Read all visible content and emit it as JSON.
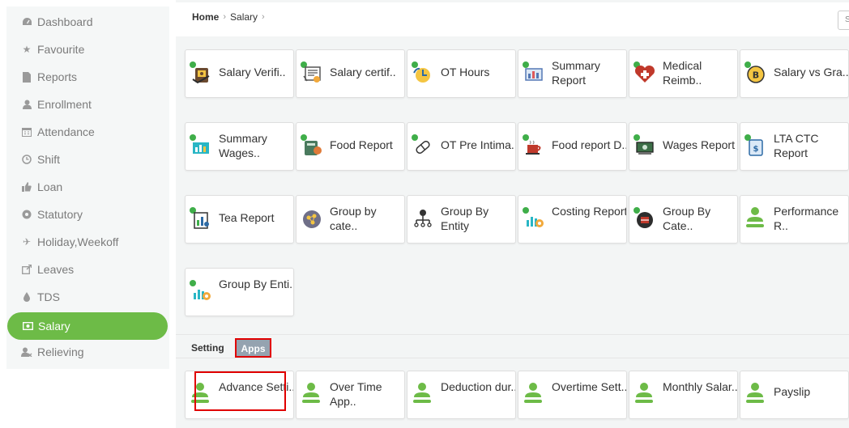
{
  "sidebar": {
    "items": [
      {
        "label": "Dashboard",
        "icon": "dashboard-icon"
      },
      {
        "label": "Favourite",
        "icon": "star-icon"
      },
      {
        "label": "Reports",
        "icon": "file-icon"
      },
      {
        "label": "Enrollment",
        "icon": "user-icon"
      },
      {
        "label": "Attendance",
        "icon": "calendar-icon"
      },
      {
        "label": "Shift",
        "icon": "clock-icon"
      },
      {
        "label": "Loan",
        "icon": "thumbs-up-icon"
      },
      {
        "label": "Statutory",
        "icon": "gear-icon"
      },
      {
        "label": "Holiday,Weekoff",
        "icon": "plane-icon"
      },
      {
        "label": "Leaves",
        "icon": "external-link-icon"
      },
      {
        "label": "TDS",
        "icon": "drop-icon"
      },
      {
        "label": "Salary",
        "icon": "money-icon",
        "active": true
      },
      {
        "label": "Relieving",
        "icon": "user-minus-icon"
      }
    ]
  },
  "breadcrumb": {
    "home": "Home",
    "current": "Salary",
    "sep": "›"
  },
  "top_search": {
    "text": "S"
  },
  "reports": [
    {
      "label": "Salary Verifi..",
      "icon": "salary-verification-icon"
    },
    {
      "label": "Salary certif..",
      "icon": "salary-certificate-icon"
    },
    {
      "label": "OT Hours",
      "icon": "ot-hours-icon"
    },
    {
      "label": "Summary Report",
      "icon": "summary-report-icon"
    },
    {
      "label": "Medical Reimb..",
      "icon": "medical-icon"
    },
    {
      "label": "Salary vs Gra..",
      "icon": "bitcoin-icon"
    },
    {
      "label": "Summary Wages..",
      "icon": "summary-wages-icon"
    },
    {
      "label": "Food Report",
      "icon": "food-icon"
    },
    {
      "label": "OT Pre Intima..",
      "icon": "pill-icon"
    },
    {
      "label": "Food report D..",
      "icon": "coffee-icon"
    },
    {
      "label": "Wages Report",
      "icon": "wages-icon"
    },
    {
      "label": "LTA CTC Report",
      "icon": "lta-icon"
    },
    {
      "label": "Tea Report",
      "icon": "tea-report-icon"
    },
    {
      "label": "Group by cate..",
      "icon": "group-category-icon"
    },
    {
      "label": "Group By Entity",
      "icon": "entity-icon"
    },
    {
      "label": "Costing Report",
      "icon": "costing-icon"
    },
    {
      "label": "Group By Cate..",
      "icon": "group-by-cate-icon"
    },
    {
      "label": "Performance R..",
      "icon": "person-icon"
    },
    {
      "label": "Group By Enti..",
      "icon": "chart-gear-icon"
    }
  ],
  "tabs": {
    "setting": "Setting",
    "apps": "Apps"
  },
  "apps": [
    {
      "label": "Advance Setti..",
      "icon": "person-icon"
    },
    {
      "label": "Over Time App..",
      "icon": "person-icon"
    },
    {
      "label": "Deduction dur..",
      "icon": "person-icon"
    },
    {
      "label": "Overtime Sett..",
      "icon": "person-icon"
    },
    {
      "label": "Monthly Salar..",
      "icon": "person-icon"
    },
    {
      "label": "Payslip",
      "icon": "person-icon"
    }
  ],
  "colors": {
    "accent": "#6dbb47",
    "highlight": "#e00000",
    "apps_tab": "#95a3b0"
  }
}
